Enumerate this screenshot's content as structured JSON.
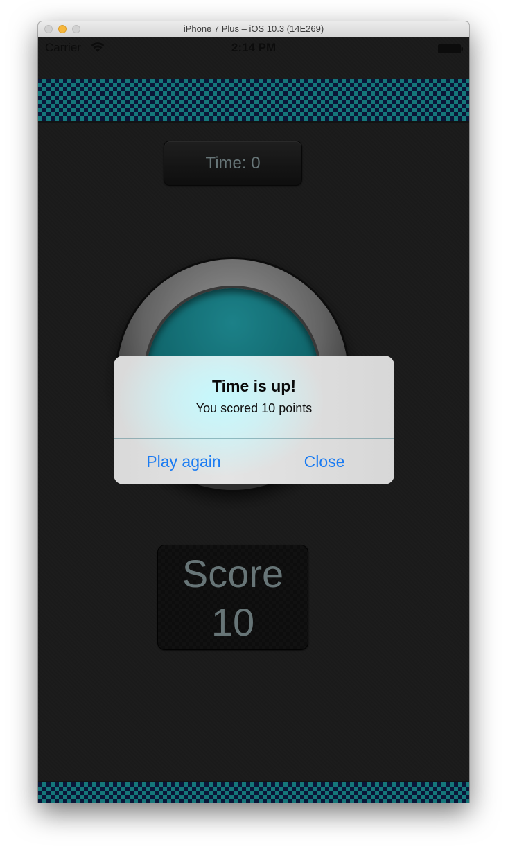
{
  "window": {
    "title": "iPhone 7 Plus – iOS 10.3 (14E269)"
  },
  "status_bar": {
    "carrier": "Carrier",
    "time": "2:14 PM",
    "icons": [
      "wifi-icon",
      "battery-icon"
    ]
  },
  "game": {
    "time_label": "Time: 0",
    "score_title": "Score",
    "score_value": "10"
  },
  "alert": {
    "title": "Time is up!",
    "message": "You scored 10 points",
    "buttons": {
      "play_again": "Play again",
      "close": "Close"
    }
  },
  "colors": {
    "accent_blue": "#1a7bf2",
    "teal": "#1ea6a9",
    "navy": "#0e1f4e",
    "label_gray": "#8fa3a6"
  }
}
